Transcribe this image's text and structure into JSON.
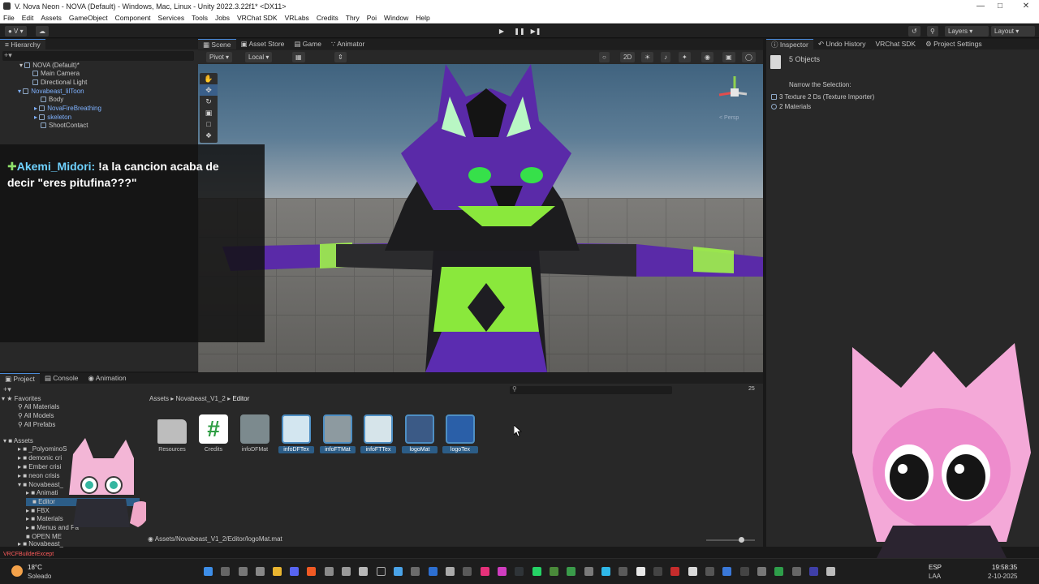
{
  "window": {
    "title": "V. Nova Neon - NOVA (Default) - Windows, Mac, Linux - Unity 2022.3.22f1* <DX11>"
  },
  "menu": [
    "File",
    "Edit",
    "Assets",
    "GameObject",
    "Component",
    "Services",
    "Tools",
    "Jobs",
    "VRChat SDK",
    "VRLabs",
    "Credits",
    "Thry",
    "Poi",
    "Window",
    "Help"
  ],
  "toolbar": {
    "layers": "Layers",
    "layout": "Layout"
  },
  "hierarchy": {
    "tab": "Hierarchy",
    "scene": "NOVA (Default)*",
    "items": [
      "Main Camera",
      "Directional Light",
      "Novabeast_lilToon",
      "Body",
      "NovaFireBreathing",
      "skeleton",
      "ShootContact"
    ]
  },
  "scene_tabs": [
    "Scene",
    "Asset Store",
    "Game",
    "Animator"
  ],
  "scene_toolbar": {
    "pivot": "Pivot",
    "local": "Local",
    "mode_2d": "2D",
    "persp": "< Persp"
  },
  "inspector": {
    "tabs": [
      "Inspector",
      "Undo History",
      "VRChat SDK",
      "Project Settings"
    ],
    "header": "5 Objects",
    "narrow": "Narrow the Selection:",
    "items": [
      "3 Texture 2 Ds (Texture Importer)",
      "2 Materials"
    ]
  },
  "chat": {
    "user": "Akemi_Midori:",
    "message_line1": " !a la cancion acaba de",
    "message_line2": "decir \"eres pitufina???\""
  },
  "bottom_tabs": [
    "Project",
    "Console",
    "Animation"
  ],
  "project": {
    "favorites_label": "Favorites",
    "favorites": [
      "All Materials",
      "All Models",
      "All Prefabs"
    ],
    "assets_label": "Assets",
    "tree": [
      "_PolyominoS",
      "demonic cri",
      "Ember crisi",
      "neon crisis",
      "Novabeast_",
      "Animati",
      "Editor",
      "FBX",
      "Materials",
      "Menus and Pa",
      "OPEN ME",
      "Novabeast_"
    ],
    "breadcrumb": [
      "Assets",
      "Novabeast_V1_2",
      "Editor"
    ],
    "count": "25",
    "assets": [
      {
        "name": "Resources",
        "selected": false,
        "color": "#c9c9c9"
      },
      {
        "name": "Credits",
        "selected": false,
        "color": "#2f9e44"
      },
      {
        "name": "infoDFMat",
        "selected": false,
        "color": "#7c8a8e"
      },
      {
        "name": "infoDFTex",
        "selected": true,
        "color": "#d3e6f0"
      },
      {
        "name": "infoFTMat",
        "selected": true,
        "color": "#8d9aa0"
      },
      {
        "name": "infoFTTex",
        "selected": true,
        "color": "#d6e4ea"
      },
      {
        "name": "logoMat",
        "selected": true,
        "color": "#3b5a86"
      },
      {
        "name": "logoTex",
        "selected": true,
        "color": "#2a5fa8"
      }
    ],
    "status_path": "Assets/Novabeast_V1_2/Editor/logoMat.mat"
  },
  "error_line": "VRCFBuilderExcept",
  "weather": {
    "temp": "18°C",
    "condition": "Soleado"
  },
  "tray": {
    "lang": "ESP",
    "region": "LAA",
    "time": "19:58:35",
    "date": "2-10-2025"
  }
}
